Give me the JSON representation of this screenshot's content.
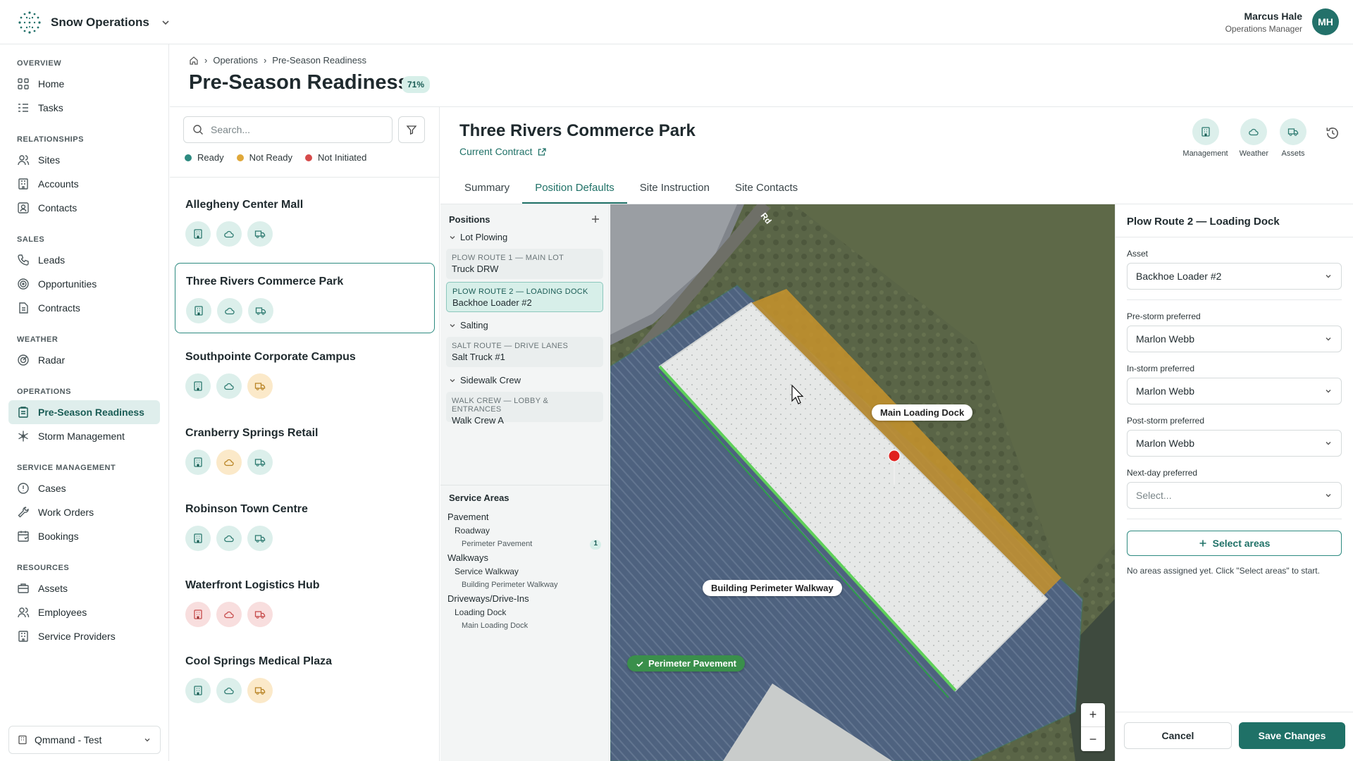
{
  "app": {
    "name": "Snow Operations"
  },
  "user": {
    "name": "Marcus Hale",
    "role": "Operations Manager",
    "initials": "MH"
  },
  "sidebar": {
    "sections": [
      {
        "title": "OVERVIEW",
        "items": [
          {
            "label": "Home",
            "icon": "grid-icon"
          },
          {
            "label": "Tasks",
            "icon": "checklist-icon"
          }
        ]
      },
      {
        "title": "RELATIONSHIPS",
        "items": [
          {
            "label": "Sites",
            "icon": "people-icon"
          },
          {
            "label": "Accounts",
            "icon": "building-icon"
          },
          {
            "label": "Contacts",
            "icon": "contact-icon"
          }
        ]
      },
      {
        "title": "SALES",
        "items": [
          {
            "label": "Leads",
            "icon": "phone-icon"
          },
          {
            "label": "Opportunities",
            "icon": "target-icon"
          },
          {
            "label": "Contracts",
            "icon": "document-icon"
          }
        ]
      },
      {
        "title": "WEATHER",
        "items": [
          {
            "label": "Radar",
            "icon": "radar-icon"
          }
        ]
      },
      {
        "title": "OPERATIONS",
        "items": [
          {
            "label": "Pre-Season Readiness",
            "icon": "clipboard-icon",
            "active": true
          },
          {
            "label": "Storm Management",
            "icon": "snowflake-icon"
          }
        ]
      },
      {
        "title": "SERVICE MANAGEMENT",
        "items": [
          {
            "label": "Cases",
            "icon": "alert-icon"
          },
          {
            "label": "Work Orders",
            "icon": "wrench-icon"
          },
          {
            "label": "Bookings",
            "icon": "calendar-icon"
          }
        ]
      },
      {
        "title": "RESOURCES",
        "items": [
          {
            "label": "Assets",
            "icon": "briefcase-icon"
          },
          {
            "label": "Employees",
            "icon": "people-icon"
          },
          {
            "label": "Service Providers",
            "icon": "building-icon"
          }
        ]
      }
    ],
    "environment": "Qmmand - Test"
  },
  "breadcrumb": {
    "items": [
      "Operations",
      "Pre-Season Readiness"
    ]
  },
  "page": {
    "title": "Pre-Season Readiness",
    "percent": "71%"
  },
  "sitelist": {
    "search_placeholder": "Search...",
    "legend": [
      {
        "label": "Ready",
        "color": "#2d8a80"
      },
      {
        "label": "Not Ready",
        "color": "#e0a83a"
      },
      {
        "label": "Not Initiated",
        "color": "#d64b4b"
      }
    ],
    "sites": [
      {
        "name": "Allegheny Center Mall",
        "status": [
          "g",
          "g",
          "g"
        ]
      },
      {
        "name": "Three Rivers Commerce Park",
        "status": [
          "g",
          "g",
          "g"
        ],
        "selected": true
      },
      {
        "name": "Southpointe Corporate Campus",
        "status": [
          "g",
          "g",
          "y"
        ]
      },
      {
        "name": "Cranberry Springs Retail",
        "status": [
          "g",
          "y",
          "g"
        ]
      },
      {
        "name": "Robinson Town Centre",
        "status": [
          "g",
          "g",
          "g"
        ]
      },
      {
        "name": "Waterfront Logistics Hub",
        "status": [
          "r",
          "r",
          "r"
        ]
      },
      {
        "name": "Cool Springs Medical Plaza",
        "status": [
          "g",
          "g",
          "y"
        ]
      }
    ]
  },
  "detail": {
    "title": "Three Rivers Commerce Park",
    "contract_link": "Current Contract",
    "icons": [
      {
        "label": "Management"
      },
      {
        "label": "Weather"
      },
      {
        "label": "Assets"
      }
    ],
    "tabs": [
      "Summary",
      "Position Defaults",
      "Site Instruction",
      "Site Contacts"
    ],
    "active_tab": 1
  },
  "positions": {
    "title": "Positions",
    "groups": [
      {
        "name": "Lot Plowing",
        "items": [
          {
            "title": "PLOW ROUTE 1 — MAIN LOT",
            "value": "Truck DRW"
          },
          {
            "title": "PLOW ROUTE 2 — LOADING DOCK",
            "value": "Backhoe Loader #2",
            "selected": true
          }
        ]
      },
      {
        "name": "Salting",
        "items": [
          {
            "title": "SALT ROUTE — DRIVE LANES",
            "value": "Salt Truck #1"
          }
        ]
      },
      {
        "name": "Sidewalk Crew",
        "items": [
          {
            "title": "WALK CREW — LOBBY & ENTRANCES",
            "value": "Walk Crew A"
          }
        ]
      }
    ]
  },
  "service_areas": {
    "title": "Service Areas",
    "tree": [
      {
        "l1": "Pavement",
        "l2": "Roadway",
        "l3": "Perimeter Pavement",
        "count": "1"
      },
      {
        "l1": "Walkways",
        "l2": "Service Walkway",
        "l3": "Building Perimeter Walkway",
        "count": ""
      },
      {
        "l1": "Driveways/Drive-Ins",
        "l2": "Loading Dock",
        "l3": "Main Loading Dock",
        "count": ""
      }
    ]
  },
  "map": {
    "labels": {
      "loading": "Main Loading Dock",
      "walkway": "Building Perimeter Walkway",
      "pavement": "Perimeter Pavement",
      "road": "Rd"
    },
    "zoom_in": "+",
    "zoom_out": "−"
  },
  "form": {
    "title": "Plow Route 2 — Loading Dock",
    "asset_label": "Asset",
    "asset_value": "Backhoe Loader #2",
    "pre_label": "Pre-storm preferred",
    "pre_value": "Marlon Webb",
    "in_label": "In-storm preferred",
    "in_value": "Marlon Webb",
    "post_label": "Post-storm preferred",
    "post_value": "Marlon Webb",
    "next_label": "Next-day preferred",
    "next_placeholder": "Select...",
    "select_areas": "Select areas",
    "no_areas": "No areas assigned yet. Click \"Select areas\" to start.",
    "cancel": "Cancel",
    "save": "Save Changes"
  }
}
